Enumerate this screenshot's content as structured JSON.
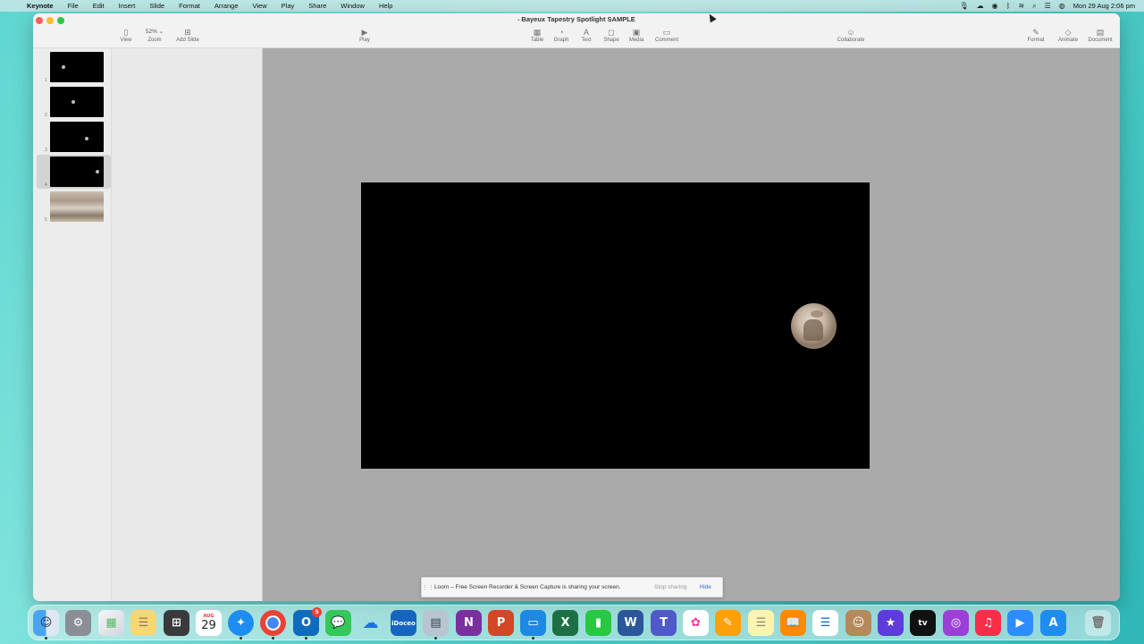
{
  "menubar": {
    "app": "Keynote",
    "items": [
      "File",
      "Edit",
      "Insert",
      "Slide",
      "Format",
      "Arrange",
      "View",
      "Play",
      "Share",
      "Window",
      "Help"
    ],
    "clock": "Mon 29 Aug  2:06 pm"
  },
  "window": {
    "title": "Bayeux Tapestry Spotlight SAMPLE"
  },
  "toolbar": {
    "view_label": "View",
    "zoom_label": "Zoom",
    "zoom_value": "52%",
    "add_slide_label": "Add Slide",
    "play_label": "Play",
    "table_label": "Table",
    "graph_label": "Graph",
    "text_label": "Text",
    "shape_label": "Shape",
    "media_label": "Media",
    "comment_label": "Comment",
    "collaborate_label": "Collaborate",
    "format_label": "Format",
    "animate_label": "Animate",
    "document_label": "Document"
  },
  "navigator": {
    "slides": [
      {
        "number": "1",
        "type": "dot"
      },
      {
        "number": "2",
        "type": "dot"
      },
      {
        "number": "3",
        "type": "dot"
      },
      {
        "number": "4",
        "type": "dot",
        "selected": true
      },
      {
        "number": "5",
        "type": "tapestry"
      }
    ]
  },
  "loom": {
    "grip": "⋮⋮",
    "message": "Loom – Free Screen Recorder & Screen Capture is sharing your screen.",
    "stop_label": "Stop sharing",
    "hide_label": "Hide"
  },
  "dock": {
    "calendar_month": "AUG",
    "calendar_day": "29",
    "outlook_badge": "5",
    "apps": [
      "Finder",
      "System Preferences",
      "Launchpad",
      "Notes",
      "Calculator",
      "Calendar",
      "Safari",
      "Chrome",
      "Outlook",
      "Messages",
      "OneDrive",
      "iDoceo",
      "Preview",
      "OneNote",
      "PowerPoint",
      "Keynote",
      "Excel",
      "Numbers",
      "Word",
      "Teams",
      "Photos",
      "Pages",
      "Notes App",
      "Books",
      "Reminders",
      "Contacts",
      "iMovie",
      "Apple TV",
      "Podcasts",
      "Music",
      "Zoom",
      "App Store",
      "Trash"
    ]
  }
}
